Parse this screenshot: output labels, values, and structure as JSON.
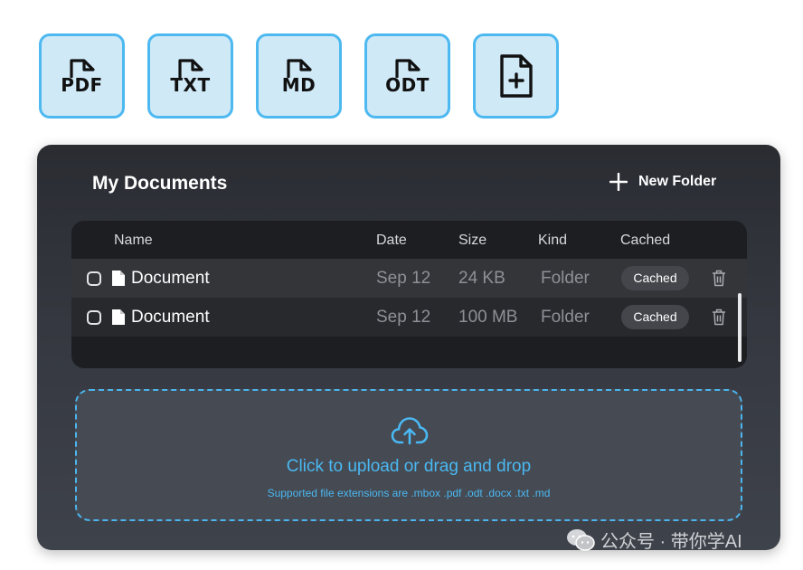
{
  "file_types": [
    {
      "label": "PDF",
      "icon": "pdf-file-icon"
    },
    {
      "label": "TXT",
      "icon": "txt-file-icon"
    },
    {
      "label": "MD",
      "icon": "md-file-icon"
    },
    {
      "label": "ODT",
      "icon": "odt-file-icon"
    },
    {
      "label": "",
      "icon": "add-file-icon"
    }
  ],
  "panel": {
    "title": "My Documents",
    "new_folder_label": "New Folder"
  },
  "table": {
    "columns": [
      "Name",
      "Date",
      "Size",
      "Kind",
      "Cached"
    ],
    "rows": [
      {
        "name": "Document",
        "date": "Sep 12",
        "size": "24 KB",
        "kind": "Folder",
        "cached": "Cached"
      },
      {
        "name": "Document",
        "date": "Sep 12",
        "size": "100 MB",
        "kind": "Folder",
        "cached": "Cached"
      }
    ]
  },
  "upload": {
    "title": "Click to upload or drag and drop",
    "subtitle": "Supported file extensions are .mbox .pdf .odt .docx .txt .md"
  },
  "watermark": {
    "text": "公众号 · 带你学AI"
  },
  "colors": {
    "accent": "#4db9f0",
    "tile_bg": "#cfe9f7",
    "panel_bg": "#2a2c32",
    "table_bg": "#1d1e21"
  }
}
